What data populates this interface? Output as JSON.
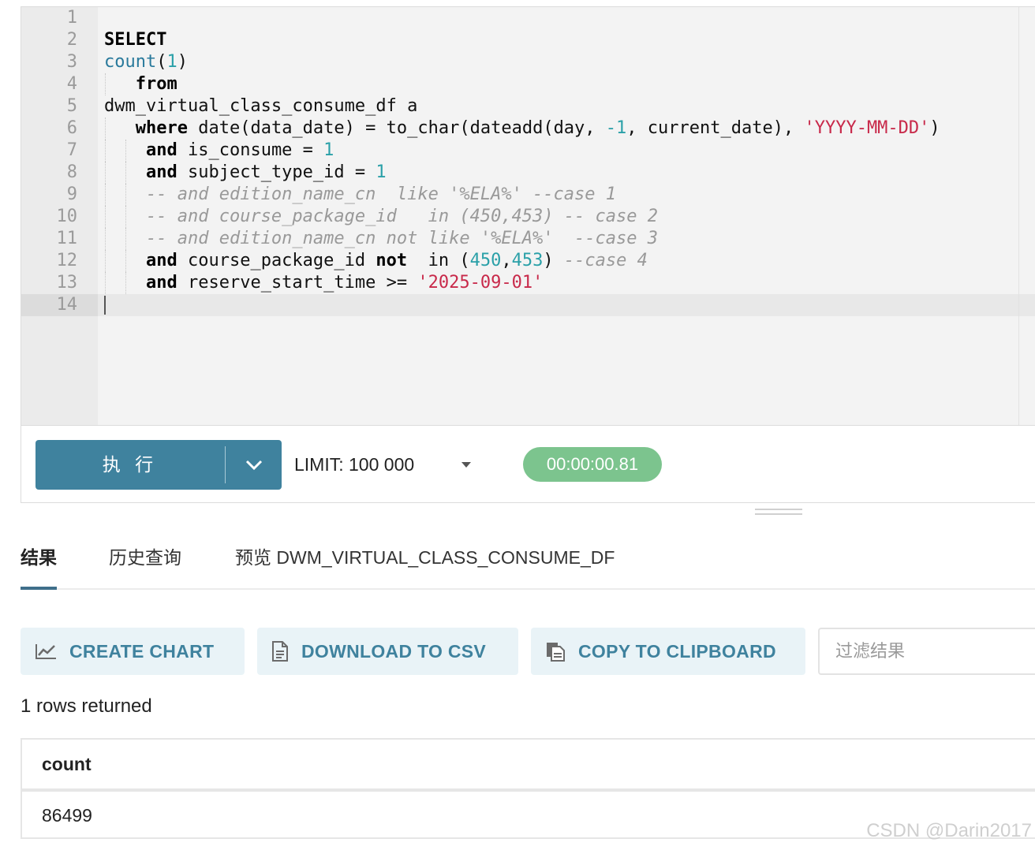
{
  "editor": {
    "line_numbers": [
      "1",
      "2",
      "3",
      "4",
      "5",
      "6",
      "7",
      "8",
      "9",
      "10",
      "11",
      "12",
      "13",
      "14"
    ],
    "active_line": 14
  },
  "toolbar": {
    "run_label": "执 行",
    "limit_label": "LIMIT:  100 000",
    "timer": "00:00:00.81"
  },
  "tabs": [
    {
      "label": "结果"
    },
    {
      "label": "历史查询"
    },
    {
      "label": "预览 DWM_VIRTUAL_CLASS_CONSUME_DF"
    }
  ],
  "actions": {
    "create_chart": "CREATE CHART",
    "download_csv": "DOWNLOAD TO CSV",
    "copy_clipboard": "COPY TO CLIPBOARD"
  },
  "filter": {
    "placeholder": "过滤结果"
  },
  "results": {
    "rows_returned": "1 rows returned",
    "columns": [
      "count"
    ],
    "rows": [
      [
        "86499"
      ]
    ]
  },
  "watermark": "CSDN @Darin2017",
  "colors": {
    "primary": "#3f829e",
    "timer_bg": "#7cc48e",
    "keyword_string": "#c8294a",
    "number": "#2aa0a8"
  }
}
